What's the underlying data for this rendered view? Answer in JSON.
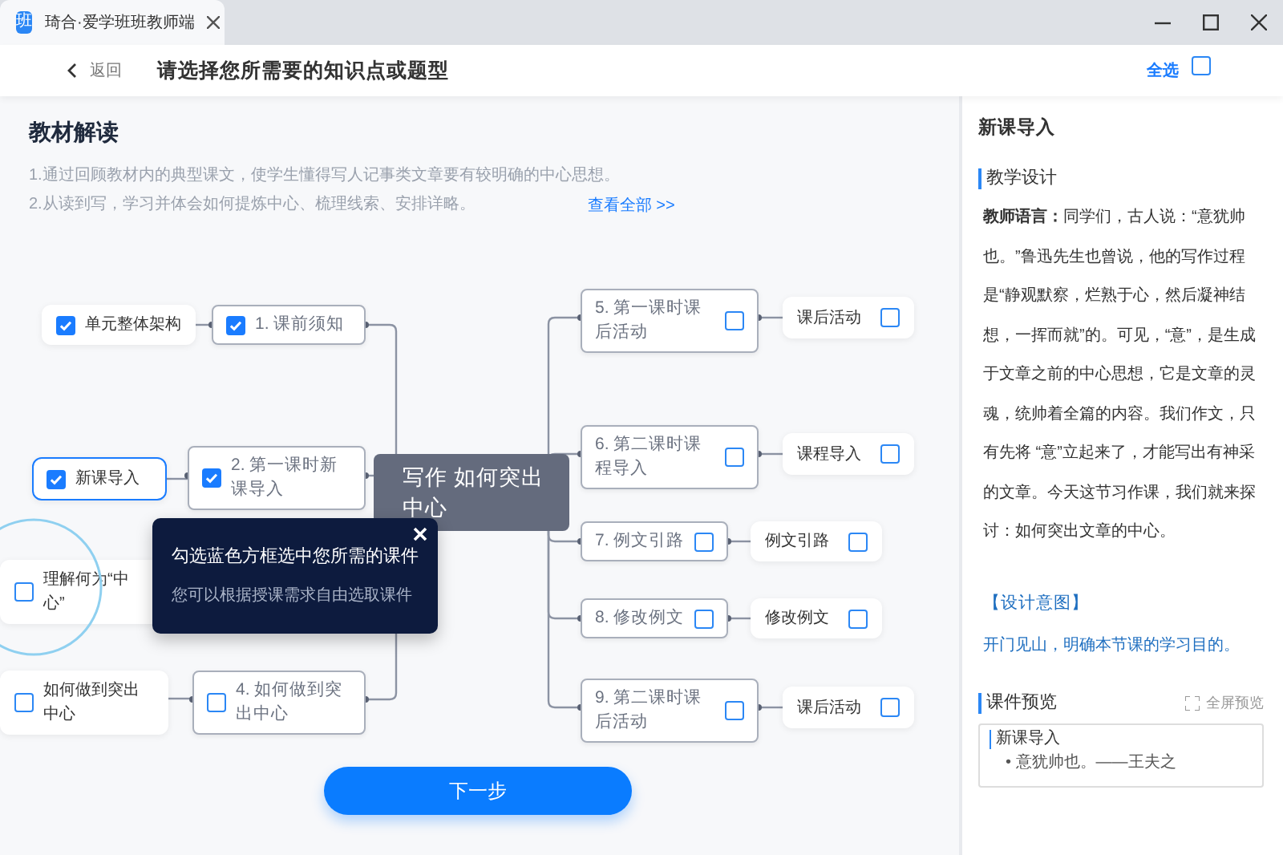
{
  "window": {
    "app_icon_text": "班",
    "tab_title": "琦合·爱学班班教师端"
  },
  "header": {
    "back_label": "返回",
    "title": "请选择您所需要的知识点或题型",
    "select_all": {
      "label": "全选",
      "checked": false
    }
  },
  "intro": {
    "heading": "教材解读",
    "lines": [
      "1.通过回顾教材内的典型课文，使学生懂得写人记事类文章要有较明确的中心思想。",
      "2.从读到写，学习并体会如何提炼中心、梳理线索、安排详略。"
    ],
    "more_link": "查看全部 >>"
  },
  "mindmap": {
    "center": "写作 如何突出中心",
    "branches": [
      {
        "label": "1. 课前须知",
        "checked": true,
        "children": [
          {
            "label": "单元整体架构",
            "checked": true,
            "selected": false
          }
        ]
      },
      {
        "label": "2. 第一课时新课导入",
        "checked": true,
        "children": [
          {
            "label": "新课导入",
            "checked": true,
            "selected": true
          }
        ]
      },
      {
        "children": [
          {
            "label": "理解何为“中心”",
            "checked": false,
            "selected": false
          }
        ]
      },
      {
        "label": "4. 如何做到突出中心",
        "checked": false,
        "children": [
          {
            "label": "如何做到突出中心",
            "checked": false,
            "selected": false
          }
        ]
      },
      {
        "label": "5. 第一课时课后活动",
        "checked": false,
        "children": [
          {
            "label": "课后活动",
            "checked": false,
            "selected": false
          }
        ]
      },
      {
        "label": "6. 第二课时课程导入",
        "checked": false,
        "children": [
          {
            "label": "课程导入",
            "checked": false,
            "selected": false
          }
        ]
      },
      {
        "label": "7. 例文引路",
        "checked": false,
        "children": [
          {
            "label": "例文引路",
            "checked": false,
            "selected": false
          }
        ]
      },
      {
        "label": "8. 修改例文",
        "checked": false,
        "children": [
          {
            "label": "修改例文",
            "checked": false,
            "selected": false
          }
        ]
      },
      {
        "label": "9. 第二课时课后活动",
        "checked": false,
        "children": [
          {
            "label": "课后活动",
            "checked": false,
            "selected": false
          }
        ]
      }
    ]
  },
  "tooltip": {
    "title": "勾选蓝色方框选中您所需的课件",
    "text": "您可以根据授课需求自由选取课件"
  },
  "next_button": "下一步",
  "detail_panel": {
    "heading": "新课导入",
    "section_title": "教学设计",
    "paragraph": "**教师语言：**同学们，古人说：“意犹帅也。”鲁迅先生也曾说，他的写作过程是“静观默察，烂熟于心，然后凝神结想，一挥而就”的。可见，“意”，是生成于文章之前的中心思想，它是文章的灵魂，统帅着全篇的内容。我们作文，只有先将 “意”立起来了，才能写出有神采的文章。今天这节习作课，我们就来探讨：如何突出文章的中心。",
    "intent_title": "【设计意图】",
    "intent_text": "开门见山，明确本节课的学习目的。",
    "preview_title": "课件预览",
    "fullscreen_label": "全屏预览",
    "slide": {
      "title": "新课导入",
      "bullet": "• 意犹帅也。——王夫之"
    }
  }
}
